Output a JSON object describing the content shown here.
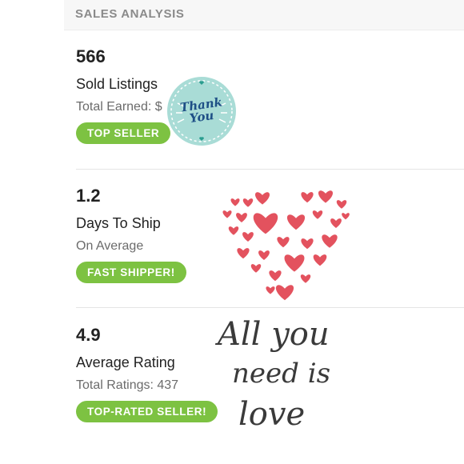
{
  "header": {
    "title": "SALES ANALYSIS"
  },
  "stats": [
    {
      "value": "566",
      "label": "Sold Listings",
      "sub": "Total Earned: $",
      "badge": "TOP SELLER"
    },
    {
      "value": "1.2",
      "label": "Days To Ship",
      "sub": "On Average",
      "badge": "FAST SHIPPER!"
    },
    {
      "value": "4.9",
      "label": "Average Rating",
      "sub": "Total Ratings: 437",
      "badge": "TOP-RATED SELLER!"
    }
  ],
  "sticker": {
    "line1": "Thank",
    "line2": "You"
  },
  "script_text": {
    "line1": "All you",
    "line2": "need is",
    "line3": "love"
  },
  "colors": {
    "badge": "#7dc242",
    "sticker_bg": "#a9dcd6",
    "sticker_text": "#1e4f86",
    "heart": "#e0404d",
    "header_bg": "#f7f7f7"
  }
}
